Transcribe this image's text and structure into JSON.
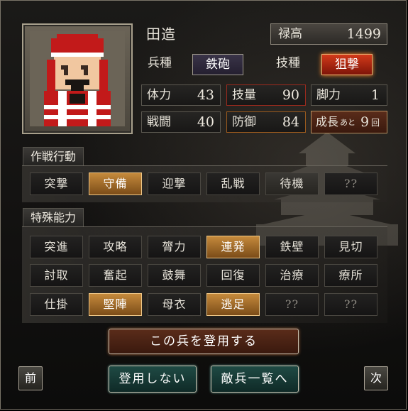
{
  "unit": {
    "name": "田造",
    "stipend_label": "禄高",
    "stipend_value": "1499",
    "troop_type_label": "兵種",
    "troop_type_value": "鉄砲",
    "skill_type_label": "技種",
    "skill_type_value": "狙撃",
    "stats": [
      {
        "label": "体力",
        "value": "43"
      },
      {
        "label": "技量",
        "value": "90"
      },
      {
        "label": "脚力",
        "value": "1"
      },
      {
        "label": "戦闘",
        "value": "40"
      },
      {
        "label": "防御",
        "value": "84"
      }
    ],
    "growth": {
      "label": "成長",
      "ato": "あと",
      "count": "9",
      "unit": "回"
    }
  },
  "tactics": {
    "title": "作戦行動",
    "items": [
      {
        "label": "突撃",
        "state": "off"
      },
      {
        "label": "守備",
        "state": "on"
      },
      {
        "label": "迎撃",
        "state": "off"
      },
      {
        "label": "乱戦",
        "state": "off"
      },
      {
        "label": "待機",
        "state": "off"
      },
      {
        "label": "??",
        "state": "dim"
      }
    ]
  },
  "abilities": {
    "title": "特殊能力",
    "rows": [
      [
        {
          "label": "突進",
          "state": "off"
        },
        {
          "label": "攻略",
          "state": "off"
        },
        {
          "label": "膂力",
          "state": "off"
        },
        {
          "label": "連発",
          "state": "on"
        },
        {
          "label": "鉄壁",
          "state": "off"
        },
        {
          "label": "見切",
          "state": "off"
        }
      ],
      [
        {
          "label": "討取",
          "state": "off"
        },
        {
          "label": "奮起",
          "state": "off"
        },
        {
          "label": "鼓舞",
          "state": "off"
        },
        {
          "label": "回復",
          "state": "off"
        },
        {
          "label": "治療",
          "state": "off"
        },
        {
          "label": "療所",
          "state": "off"
        }
      ],
      [
        {
          "label": "仕掛",
          "state": "off"
        },
        {
          "label": "堅陣",
          "state": "on"
        },
        {
          "label": "母衣",
          "state": "off"
        },
        {
          "label": "逃足",
          "state": "on"
        },
        {
          "label": "??",
          "state": "dim"
        },
        {
          "label": "??",
          "state": "dim"
        }
      ]
    ]
  },
  "buttons": {
    "register": "この兵を登用する",
    "decline": "登用しない",
    "enemy_list": "敵兵一覧へ",
    "prev": "前",
    "next": "次"
  },
  "colors": {
    "active_skill": "#c58a3c",
    "skill_type_red": "#d23a1a",
    "troop_type_purple": "#3a3448",
    "action_teal": "#1f4a44"
  }
}
